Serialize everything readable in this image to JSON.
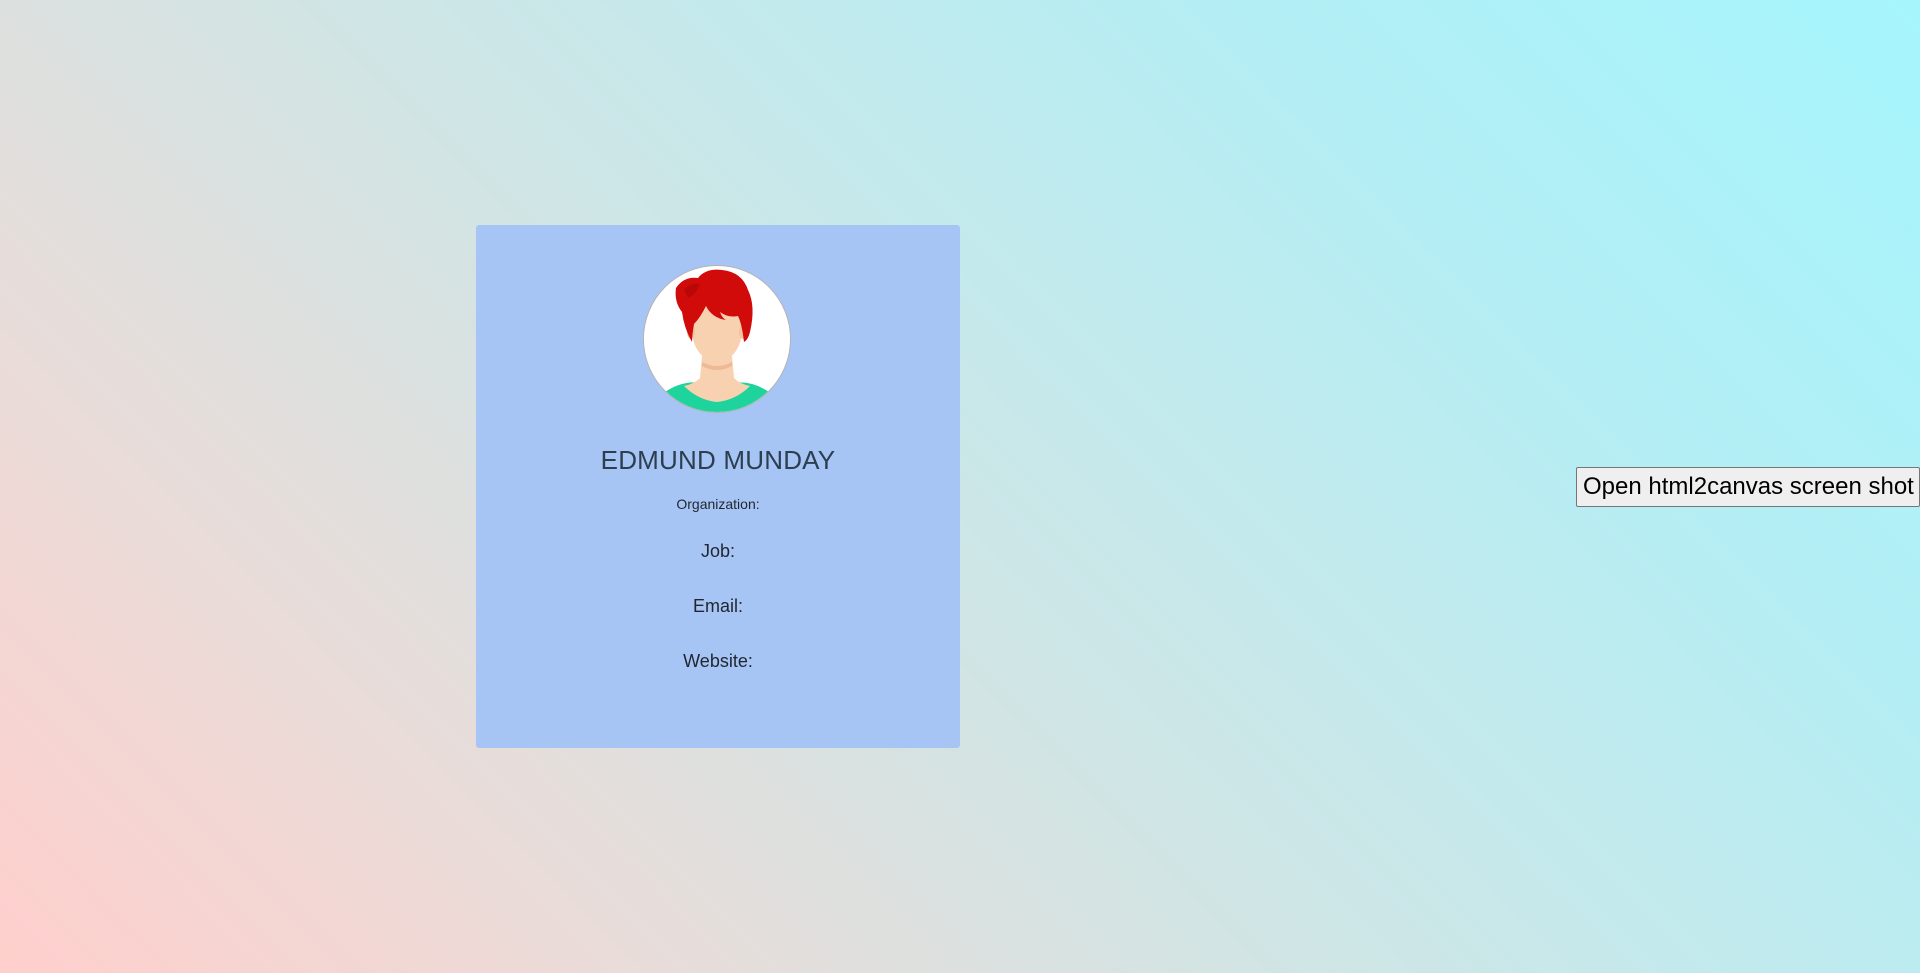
{
  "profile_card": {
    "name": "EDMUND MUNDAY",
    "organization_label": "Organization:",
    "job_label": "Job:",
    "email_label": "Email:",
    "website_label": "Website:",
    "avatar_icon": "female-avatar-icon"
  },
  "toolbar": {
    "screenshot_button_label": "Open html2canvas screen shot"
  },
  "colors": {
    "card_background": "#a7c5f4",
    "name_color": "#2c3e50",
    "gradient_start": "#ffcfcc",
    "gradient_end": "#a6f5fd",
    "avatar_hair": "#d10a0a",
    "avatar_shirt": "#1fd49c",
    "avatar_skin": "#f8d1b1"
  }
}
